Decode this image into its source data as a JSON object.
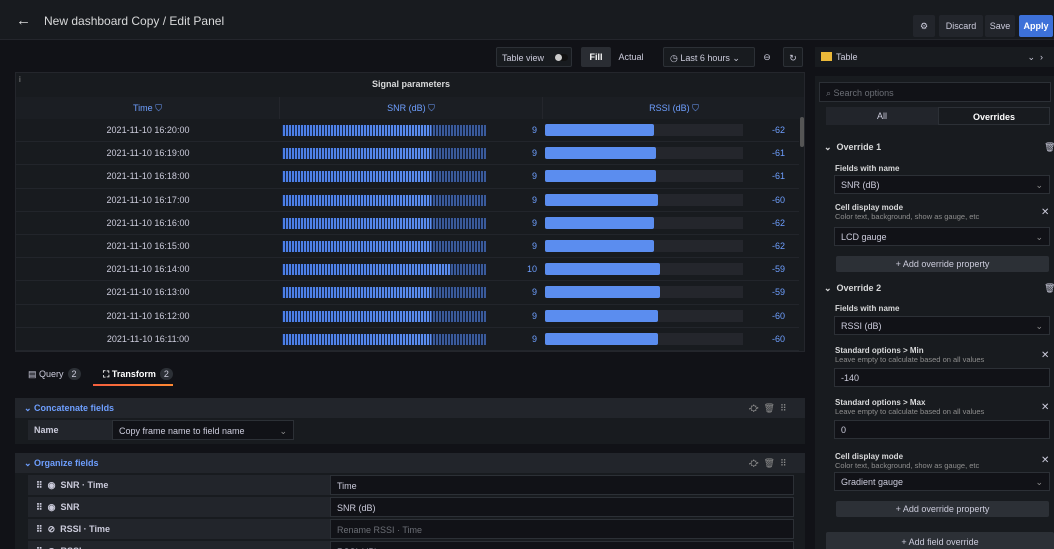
{
  "header": {
    "title": "New dashboard Copy / Edit Panel",
    "discard": "Discard",
    "save": "Save",
    "apply": "Apply"
  },
  "toolbar": {
    "table_view": "Table view",
    "fill": "Fill",
    "actual": "Actual",
    "time_range": "Last 6 hours",
    "visualization": "Table"
  },
  "panel": {
    "title": "Signal parameters",
    "columns": [
      "Time",
      "SNR (dB)",
      "RSSI (dB)"
    ],
    "rows": [
      {
        "time": "2021-11-10 16:20:00",
        "snr": "9",
        "rssi": "-62",
        "snr_frac": 0.73,
        "rssi_frac": 0.55
      },
      {
        "time": "2021-11-10 16:19:00",
        "snr": "9",
        "rssi": "-61",
        "snr_frac": 0.73,
        "rssi_frac": 0.56
      },
      {
        "time": "2021-11-10 16:18:00",
        "snr": "9",
        "rssi": "-61",
        "snr_frac": 0.73,
        "rssi_frac": 0.56
      },
      {
        "time": "2021-11-10 16:17:00",
        "snr": "9",
        "rssi": "-60",
        "snr_frac": 0.73,
        "rssi_frac": 0.57
      },
      {
        "time": "2021-11-10 16:16:00",
        "snr": "9",
        "rssi": "-62",
        "snr_frac": 0.73,
        "rssi_frac": 0.55
      },
      {
        "time": "2021-11-10 16:15:00",
        "snr": "9",
        "rssi": "-62",
        "snr_frac": 0.73,
        "rssi_frac": 0.55
      },
      {
        "time": "2021-11-10 16:14:00",
        "snr": "10",
        "rssi": "-59",
        "snr_frac": 0.83,
        "rssi_frac": 0.58
      },
      {
        "time": "2021-11-10 16:13:00",
        "snr": "9",
        "rssi": "-59",
        "snr_frac": 0.73,
        "rssi_frac": 0.58
      },
      {
        "time": "2021-11-10 16:12:00",
        "snr": "9",
        "rssi": "-60",
        "snr_frac": 0.73,
        "rssi_frac": 0.57
      },
      {
        "time": "2021-11-10 16:11:00",
        "snr": "9",
        "rssi": "-60",
        "snr_frac": 0.73,
        "rssi_frac": 0.57
      }
    ]
  },
  "tabs": {
    "query": "Query",
    "query_count": "2",
    "transform": "Transform",
    "transform_count": "2"
  },
  "transforms": {
    "concat_title": "Concatenate fields",
    "concat_name_label": "Name",
    "concat_name_value": "Copy frame name to field name",
    "organize_title": "Organize fields",
    "organize_rows": [
      {
        "field": "SNR · Time",
        "rename": "Time",
        "placeholder": false
      },
      {
        "field": "SNR",
        "rename": "SNR (dB)",
        "placeholder": false
      },
      {
        "field": "RSSI · Time",
        "rename": "Rename RSSI · Time",
        "placeholder": true
      },
      {
        "field": "RSSI",
        "rename": "RSSI (dB)",
        "placeholder": false
      }
    ]
  },
  "options": {
    "search_placeholder": "Search options",
    "tab_all": "All",
    "tab_overrides": "Overrides",
    "override1": {
      "title": "Override 1",
      "fields_with_name": "Fields with name",
      "field": "SNR (dB)",
      "prop_label": "Cell display mode",
      "prop_desc": "Color text, background, show as gauge, etc",
      "prop_value": "LCD gauge",
      "add_prop": "+ Add override property"
    },
    "override2": {
      "title": "Override 2",
      "fields_with_name": "Fields with name",
      "field": "RSSI (dB)",
      "min_label": "Standard options > Min",
      "min_desc": "Leave empty to calculate based on all values",
      "min_value": "-140",
      "max_label": "Standard options > Max",
      "max_desc": "Leave empty to calculate based on all values",
      "max_value": "0",
      "prop_label": "Cell display mode",
      "prop_desc": "Color text, background, show as gauge, etc",
      "prop_value": "Gradient gauge",
      "add_prop": "+ Add override property"
    },
    "add_field_override": "+ Add field override"
  },
  "colors": {
    "accent": "#3d71d9",
    "link": "#6e9fff",
    "bar": "#5b8def",
    "tab_underline": "#f55f3e",
    "viz_icon": "#eab839"
  }
}
